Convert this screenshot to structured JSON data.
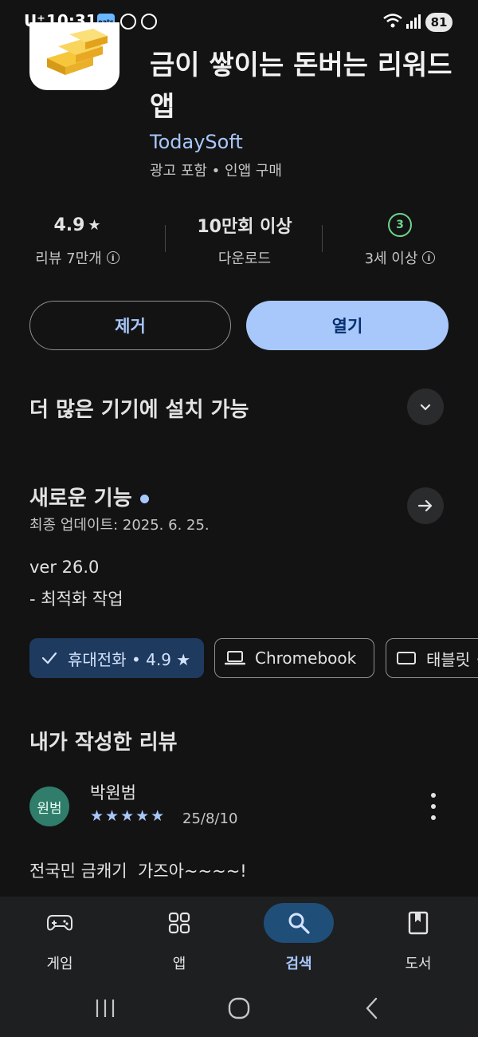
{
  "status_bar": {
    "carrier": "U⁺",
    "time": "10:31",
    "eats_label": "eats",
    "battery": "81"
  },
  "app": {
    "title": "금이 쌓이는 돈버는 리워드 앱",
    "developer": "TodaySoft",
    "meta": "광고 포함 • 인앱 구매",
    "icon_name": "gold-bars-icon"
  },
  "stats": {
    "rating": "4.9",
    "rating_label": "리뷰 7만개",
    "downloads": "10만회 이상",
    "downloads_label": "다운로드",
    "age_badge": "3",
    "age_label": "3세 이상"
  },
  "buttons": {
    "remove": "제거",
    "open": "열기"
  },
  "more_devices": {
    "title": "더 많은 기기에 설치 가능"
  },
  "whats_new": {
    "title": "새로운 기능",
    "updated": "최종 업데이트: 2025. 6. 25.",
    "version": "ver 26.0",
    "notes": "- 최적화 작업"
  },
  "device_chips": [
    {
      "label": "휴대전화 • 4.9 ★",
      "icon": "check-icon",
      "selected": true
    },
    {
      "label": "Chromebook",
      "icon": "laptop-icon",
      "selected": false
    },
    {
      "label": "태블릿 •",
      "icon": "tablet-icon",
      "selected": false
    }
  ],
  "my_review": {
    "title": "내가 작성한 리뷰",
    "avatar_text": "원범",
    "reviewer": "박원범",
    "stars": "★★★★★",
    "rating_value": 5,
    "date": "25/8/10",
    "text": "전국민 금캐기  가즈아~~~~!"
  },
  "bottom_nav": [
    {
      "label": "게임",
      "icon": "gamepad-icon",
      "active": false
    },
    {
      "label": "앱",
      "icon": "apps-grid-icon",
      "active": false
    },
    {
      "label": "검색",
      "icon": "search-icon",
      "active": true
    },
    {
      "label": "도서",
      "icon": "book-icon",
      "active": false
    }
  ],
  "colors": {
    "background": "#131314",
    "accent": "#a8c7fa",
    "on_accent": "#062e6f",
    "age_green": "#6dd58c"
  }
}
